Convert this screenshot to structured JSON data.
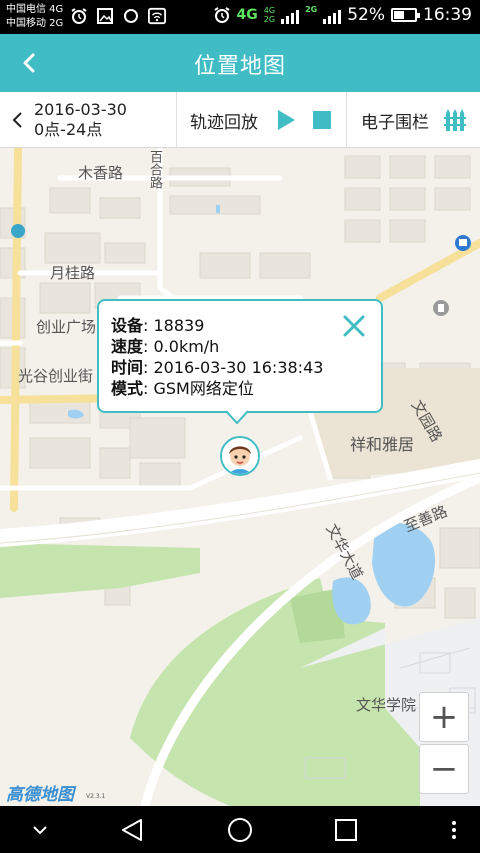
{
  "status_bar": {
    "carrier_1": "中国电信 4G",
    "carrier_2": "中国移动 2G",
    "battery": "52%",
    "battery_level": 0.52,
    "time": "16:39",
    "network_4g": "4G",
    "network_small_top": "4G",
    "network_small_bottom": "2G",
    "network_2g": "2G"
  },
  "header": {
    "title": "位置地图"
  },
  "toolbar": {
    "date": "2016-03-30",
    "time_range": "0点-24点",
    "playback_label": "轨迹回放",
    "fence_label": "电子围栏"
  },
  "map": {
    "labels": {
      "muxiang_road": "木香路",
      "yuegui_road": "月桂路",
      "chuangye_square": "创业广场",
      "guanggu_street": "光谷创业街",
      "wenyuan_road": "文园路",
      "xianghe_yaju": "祥和雅居",
      "zhishan_road": "至善路",
      "wenhua_avenue": "文华大道",
      "wenhua_college": "文华学院",
      "vertical_road": "百合路"
    },
    "logo": "高德地图",
    "logo_version": "V2.3.1",
    "zoom_in": "+",
    "zoom_out": "−"
  },
  "popup": {
    "device_label": "设备",
    "device_value": ": 18839",
    "speed_label": "速度",
    "speed_value": ": 0.0km/h",
    "time_label": "时间",
    "time_value": ": 2016-03-30 16:38:43",
    "mode_label": "模式",
    "mode_value": ": GSM网络定位"
  },
  "colors": {
    "accent": "#3fbcc4",
    "map_background": "#f4f1ea",
    "park_green": "#c6e4ad",
    "water": "#9fd0f2"
  },
  "icons": [
    "back-icon",
    "chevron-left-icon",
    "play-icon",
    "stop-icon",
    "fence-icon",
    "close-icon",
    "avatar-icon",
    "nav-down-icon",
    "nav-back-icon",
    "nav-home-icon",
    "nav-recent-icon",
    "nav-more-icon"
  ]
}
